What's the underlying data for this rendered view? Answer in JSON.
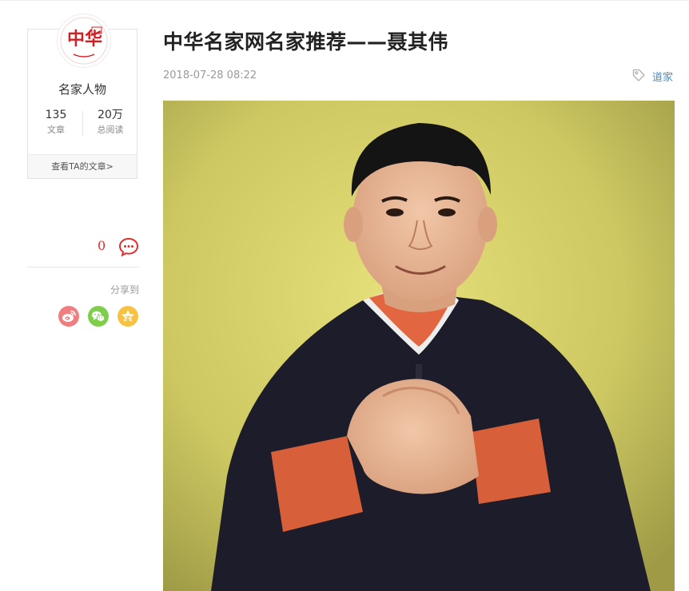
{
  "author": {
    "avatar_icon": "zhonghua-logo",
    "avatar_glyphs": "中华",
    "name": "名家人物",
    "stats": [
      {
        "value": "135",
        "label": "文章"
      },
      {
        "value": "20万",
        "label": "总阅读"
      }
    ],
    "view_articles_label": "查看TA的文章>"
  },
  "comments": {
    "count": "0",
    "icon": "comment-bubble-icon",
    "accent_color": "#e0302e"
  },
  "share": {
    "label": "分享到",
    "buttons": [
      {
        "name": "weibo",
        "icon": "weibo-icon",
        "color": "#f07d7f"
      },
      {
        "name": "wechat",
        "icon": "wechat-icon",
        "color": "#7ece4b"
      },
      {
        "name": "qzone",
        "icon": "star-icon",
        "color": "#f7c242"
      }
    ]
  },
  "article": {
    "title": "中华名家网名家推荐——聂其伟",
    "time": "2018-07-28 08:22",
    "tag": "道家",
    "tag_color": "#4a8bc2",
    "image_icon": "portrait-photo"
  }
}
